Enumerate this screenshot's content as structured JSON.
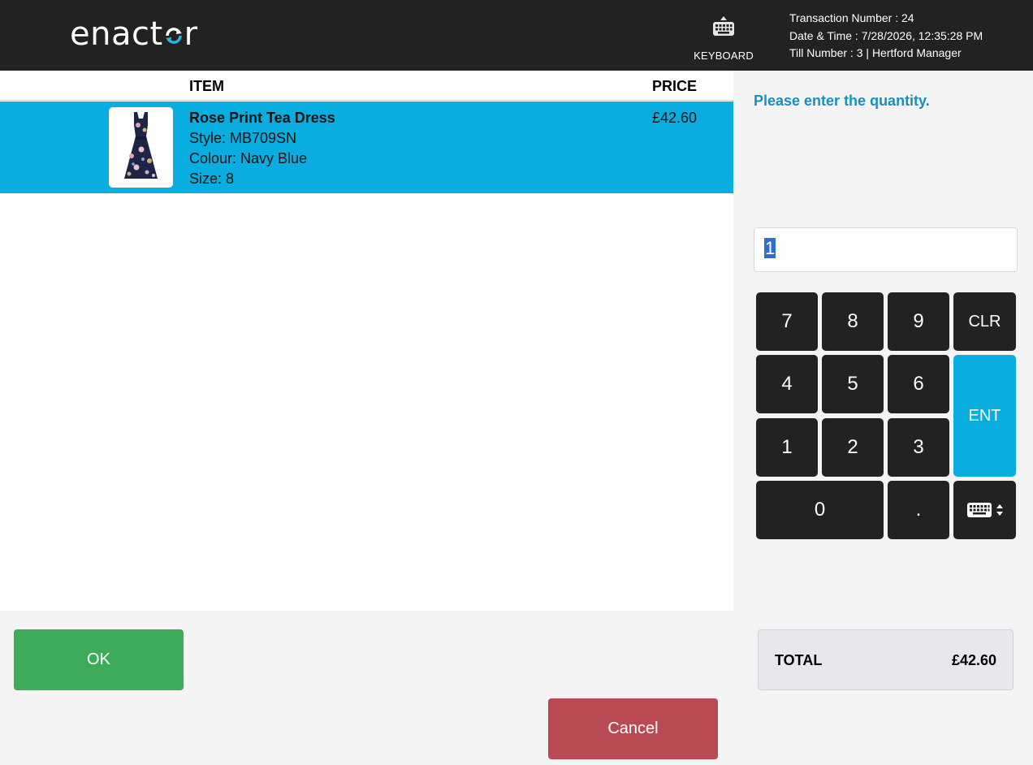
{
  "header": {
    "logo_text_start": "enact",
    "logo_text_end": "r",
    "keyboard_label": "KEYBOARD",
    "transaction_number": "Transaction Number : 24",
    "date_time": "Date & Time : 7/28/2026, 12:35:28 PM",
    "till_number": "Till Number : 3",
    "separator": "|",
    "operator": "Hertford Manager"
  },
  "list": {
    "col_item": "ITEM",
    "col_price": "PRICE",
    "items": [
      {
        "name": "Rose Print Tea Dress",
        "style": "Style: MB709SN",
        "colour": "Colour: Navy Blue",
        "size": "Size: 8",
        "price": "£42.60"
      }
    ]
  },
  "entry": {
    "prompt": "Please enter the quantity.",
    "value": "1"
  },
  "keypad": {
    "k7": "7",
    "k8": "8",
    "k9": "9",
    "clr": "CLR",
    "k4": "4",
    "k5": "5",
    "k6": "6",
    "ent": "ENT",
    "k1": "1",
    "k2": "2",
    "k3": "3",
    "k0": "0",
    "dot": ".",
    "kbd_toggle_icon": "keyboard-toggle-icon"
  },
  "total": {
    "label": "TOTAL",
    "value": "£42.60"
  },
  "actions": {
    "ok": "OK",
    "cancel": "Cancel"
  },
  "colors": {
    "header_bg": "#222222",
    "accent_blue": "#09ade0",
    "ok_green": "#3dab5a",
    "cancel_red": "#b94a53",
    "prompt_blue": "#1a8fbf"
  }
}
